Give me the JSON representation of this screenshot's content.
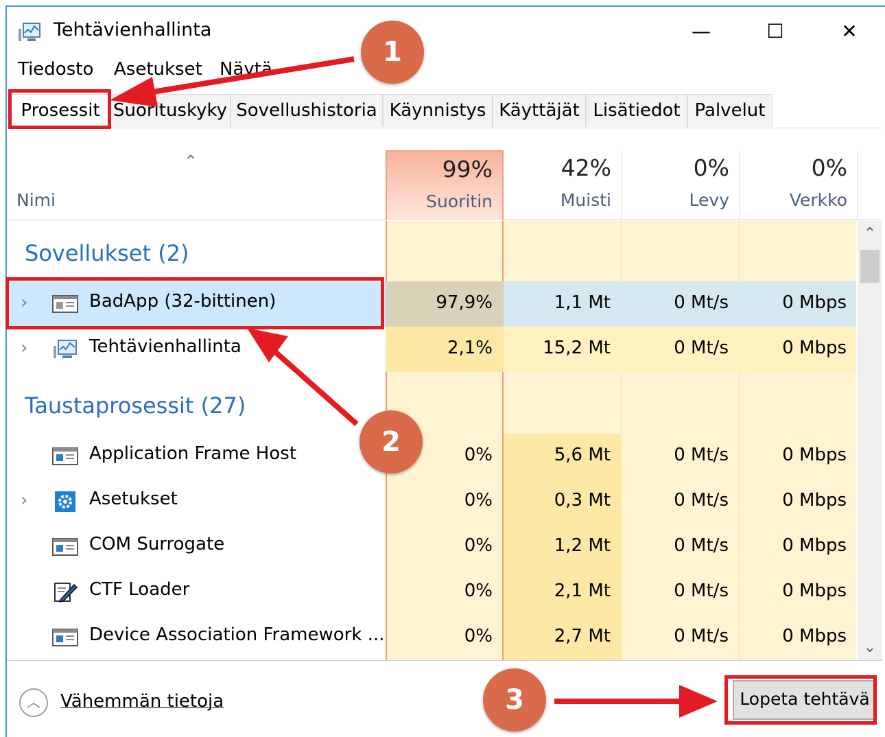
{
  "window": {
    "title": "Tehtävienhallinta",
    "controls": {
      "minimize": "—",
      "maximize": "☐",
      "close": "✕"
    }
  },
  "menu": [
    "Tiedosto",
    "Asetukset",
    "Näytä"
  ],
  "tabs": [
    "Prosessit",
    "Suorituskyky",
    "Sovellushistoria",
    "Käynnistys",
    "Käyttäjät",
    "Lisätiedot",
    "Palvelut"
  ],
  "header": {
    "name_label": "Nimi",
    "sort_icon": "⌃",
    "columns": [
      {
        "pct": "99%",
        "label": "Suoritin"
      },
      {
        "pct": "42%",
        "label": "Muisti"
      },
      {
        "pct": "0%",
        "label": "Levy"
      },
      {
        "pct": "0%",
        "label": "Verkko"
      }
    ]
  },
  "groups": {
    "apps": "Sovellukset (2)",
    "background": "Taustaprosessit (27)"
  },
  "rows": [
    {
      "name": "BadApp (32-bittinen)",
      "cpu": "97,9%",
      "mem": "1,1 Mt",
      "disk": "0 Mt/s",
      "net": "0 Mbps",
      "icon": "window-app-icon",
      "expandable": true
    },
    {
      "name": "Tehtävienhallinta",
      "cpu": "2,1%",
      "mem": "15,2 Mt",
      "disk": "0 Mt/s",
      "net": "0 Mbps",
      "icon": "task-manager-icon",
      "expandable": true
    },
    {
      "name": "Application Frame Host",
      "cpu": "0%",
      "mem": "5,6 Mt",
      "disk": "0 Mt/s",
      "net": "0 Mbps",
      "icon": "window-app-icon",
      "expandable": false
    },
    {
      "name": "Asetukset",
      "cpu": "0%",
      "mem": "0,3 Mt",
      "disk": "0 Mt/s",
      "net": "0 Mbps",
      "icon": "settings-gear-icon",
      "expandable": true
    },
    {
      "name": "COM Surrogate",
      "cpu": "0%",
      "mem": "1,2 Mt",
      "disk": "0 Mt/s",
      "net": "0 Mbps",
      "icon": "window-app-icon",
      "expandable": false
    },
    {
      "name": "CTF Loader",
      "cpu": "0%",
      "mem": "2,1 Mt",
      "disk": "0 Mt/s",
      "net": "0 Mbps",
      "icon": "pen-icon",
      "expandable": false
    },
    {
      "name": "Device Association Framework ...",
      "cpu": "0%",
      "mem": "2,7 Mt",
      "disk": "0 Mt/s",
      "net": "0 Mbps",
      "icon": "window-app-icon",
      "expandable": false
    }
  ],
  "chevron": "›",
  "scroll": {
    "up": "⌃",
    "down": "⌄"
  },
  "footer": {
    "fewer_details": "Vähemmän tietoja",
    "fewer_icon": "︿",
    "end_task": "Lopeta tehtävä"
  },
  "annotations": {
    "badge1": "1",
    "badge2": "2",
    "badge3": "3"
  },
  "colors": {
    "annotation_red": "#e31b23",
    "badge": "#d96b4a",
    "group_blue": "#2a6ec3",
    "selection": "#cce8ff",
    "cpu_highlight": "#f9b39c"
  }
}
